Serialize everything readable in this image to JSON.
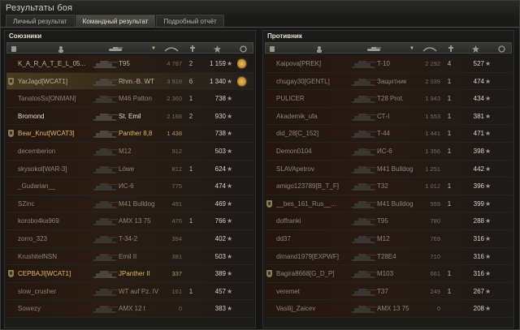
{
  "window": {
    "title": "Результаты боя"
  },
  "tabs": [
    {
      "label": "Личный результат",
      "active": false
    },
    {
      "label": "Командный результат",
      "active": true
    },
    {
      "label": "Подробный отчёт",
      "active": false
    }
  ],
  "allies": {
    "title": "Союзники",
    "rows": [
      {
        "name": "K_A_R_A_T_E_L_05...",
        "tank": "T95",
        "damage": "4 787",
        "kills": "2",
        "xp": "1 159",
        "badge": false,
        "medal": true,
        "style": "normal"
      },
      {
        "name": "YarJagd[WCAT1]",
        "tank": "Rhm.-B. WT",
        "damage": "3 918",
        "kills": "6",
        "xp": "1 340",
        "badge": true,
        "medal": true,
        "style": "hl"
      },
      {
        "name": "TanatosSs[ONMAN]",
        "tank": "M46 Patton",
        "damage": "2 360",
        "kills": "1",
        "xp": "738",
        "badge": false,
        "medal": false,
        "style": "dead"
      },
      {
        "name": "Bromond",
        "tank": "St. Emil",
        "damage": "2 198",
        "kills": "2",
        "xp": "930",
        "badge": false,
        "medal": false,
        "style": "bright"
      },
      {
        "name": "Bear_Knut[WCAT3]",
        "tank": "Panther 8,8",
        "damage": "1 438",
        "kills": "",
        "xp": "738",
        "badge": true,
        "medal": false,
        "style": "yellow"
      },
      {
        "name": "decemberion",
        "tank": "M12",
        "damage": "912",
        "kills": "",
        "xp": "503",
        "badge": false,
        "medal": false,
        "style": "dead"
      },
      {
        "name": "skysokol[WAR-3]",
        "tank": "Löwe",
        "damage": "812",
        "kills": "1",
        "xp": "624",
        "badge": false,
        "medal": false,
        "style": "dead"
      },
      {
        "name": "_Gudarian__",
        "tank": "ИС-6",
        "damage": "775",
        "kills": "",
        "xp": "474",
        "badge": false,
        "medal": false,
        "style": "dead"
      },
      {
        "name": "SZinc",
        "tank": "M41 Bulldog",
        "damage": "491",
        "kills": "",
        "xp": "469",
        "badge": false,
        "medal": false,
        "style": "dead"
      },
      {
        "name": "korobo4ka969",
        "tank": "AMX 13 75",
        "damage": "476",
        "kills": "1",
        "xp": "766",
        "badge": false,
        "medal": false,
        "style": "dead"
      },
      {
        "name": "zorro_323",
        "tank": "T-34-2",
        "damage": "394",
        "kills": "",
        "xp": "402",
        "badge": false,
        "medal": false,
        "style": "dead"
      },
      {
        "name": "KrushitelNSN",
        "tank": "Emil II",
        "damage": "381",
        "kills": "",
        "xp": "503",
        "badge": false,
        "medal": false,
        "style": "dead"
      },
      {
        "name": "CEPBAJI[WCAT1]",
        "tank": "JPanther II",
        "damage": "337",
        "kills": "",
        "xp": "389",
        "badge": true,
        "medal": false,
        "style": "yellow"
      },
      {
        "name": "slow_crusher",
        "tank": "WT auf Pz. IV",
        "damage": "161",
        "kills": "1",
        "xp": "457",
        "badge": false,
        "medal": false,
        "style": "dead"
      },
      {
        "name": "Sowezy",
        "tank": "AMX 12 t",
        "damage": "0",
        "kills": "",
        "xp": "383",
        "badge": false,
        "medal": false,
        "style": "dead"
      }
    ]
  },
  "enemies": {
    "title": "Противник",
    "rows": [
      {
        "name": "Kaipova[PREK]",
        "tank": "T-10",
        "damage": "2 292",
        "kills": "4",
        "xp": "527",
        "badge": false,
        "style": "dead"
      },
      {
        "name": "chugay30[GENTL]",
        "tank": "Защитник",
        "damage": "2 039",
        "kills": "1",
        "xp": "474",
        "badge": false,
        "style": "dead"
      },
      {
        "name": "PULICER",
        "tank": "T28 Prot.",
        "damage": "1 943",
        "kills": "1",
        "xp": "434",
        "badge": false,
        "style": "dead"
      },
      {
        "name": "Akademik_ufa",
        "tank": "СТ-I",
        "damage": "1 553",
        "kills": "1",
        "xp": "381",
        "badge": false,
        "style": "dead"
      },
      {
        "name": "did_28[C_152]",
        "tank": "T-44",
        "damage": "1 441",
        "kills": "1",
        "xp": "471",
        "badge": false,
        "style": "dead"
      },
      {
        "name": "Demon0104",
        "tank": "ИС-6",
        "damage": "1 356",
        "kills": "1",
        "xp": "398",
        "badge": false,
        "style": "dead"
      },
      {
        "name": "SLAVApetrov",
        "tank": "M41 Bulldog",
        "damage": "1 251",
        "kills": "",
        "xp": "442",
        "badge": false,
        "style": "dead"
      },
      {
        "name": "amigo123789[B_T_F]",
        "tank": "T32",
        "damage": "1 012",
        "kills": "1",
        "xp": "396",
        "badge": false,
        "style": "dead"
      },
      {
        "name": "__bes_161_Rus__...",
        "tank": "M41 Bulldog",
        "damage": "959",
        "kills": "1",
        "xp": "399",
        "badge": true,
        "style": "dead"
      },
      {
        "name": "doffranki",
        "tank": "T95",
        "damage": "780",
        "kills": "",
        "xp": "288",
        "badge": false,
        "style": "dead"
      },
      {
        "name": "dd37",
        "tank": "M12",
        "damage": "769",
        "kills": "",
        "xp": "316",
        "badge": false,
        "style": "dead"
      },
      {
        "name": "dimand1979[EXPWF]",
        "tank": "T28E4",
        "damage": "710",
        "kills": "",
        "xp": "316",
        "badge": false,
        "style": "dead"
      },
      {
        "name": "Bagira8668[G_D_P]",
        "tank": "M103",
        "damage": "661",
        "kills": "1",
        "xp": "316",
        "badge": true,
        "style": "dead"
      },
      {
        "name": "veremet",
        "tank": "T37",
        "damage": "249",
        "kills": "1",
        "xp": "267",
        "badge": false,
        "style": "dead"
      },
      {
        "name": "Vasilij_Zaicev",
        "tank": "AMX 13 75",
        "damage": "0",
        "kills": "",
        "xp": "208",
        "badge": false,
        "style": "dead"
      }
    ]
  },
  "columns": {
    "icons": [
      "platoon-icon",
      "player-icon",
      "tank-icon",
      "damage-icon",
      "kills-icon",
      "xp-icon",
      "medal-icon"
    ],
    "sort_indicator": "▼"
  },
  "colors": {
    "accent": "#e0b86a",
    "medal": "#f0c060"
  }
}
